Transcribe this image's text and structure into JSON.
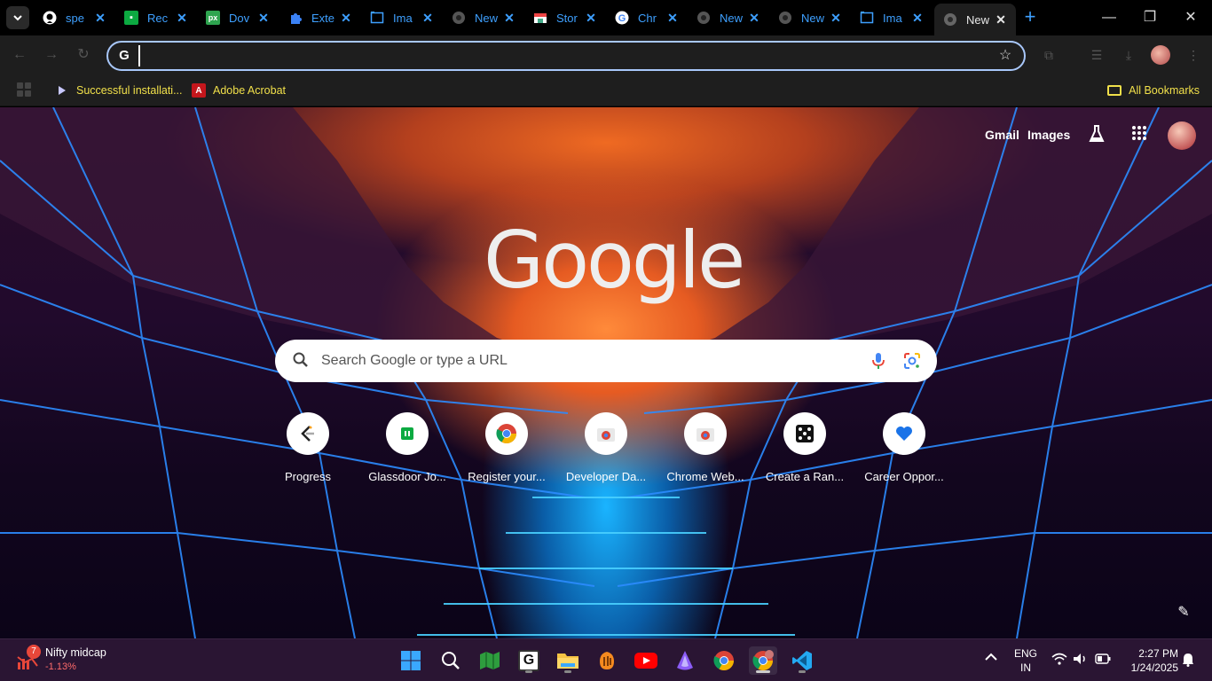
{
  "tabs": [
    {
      "label": "spe",
      "favicon": "github-icon"
    },
    {
      "label": "Rec",
      "favicon": "glassdoor-icon"
    },
    {
      "label": "Dov",
      "favicon": "pixabay-icon"
    },
    {
      "label": "Exte",
      "favicon": "extension-icon"
    },
    {
      "label": "Ima",
      "favicon": "image-icon"
    },
    {
      "label": "New",
      "favicon": "chrome-icon"
    },
    {
      "label": "Stor",
      "favicon": "store-icon"
    },
    {
      "label": "Chr",
      "favicon": "google-icon"
    },
    {
      "label": "New",
      "favicon": "chrome-icon"
    },
    {
      "label": "New",
      "favicon": "chrome-icon"
    },
    {
      "label": "Ima",
      "favicon": "image-icon"
    },
    {
      "label": "New",
      "favicon": "chrome-icon",
      "active": true
    }
  ],
  "omnibox": {
    "value": "",
    "placeholder": ""
  },
  "bookmarks": {
    "items": [
      {
        "label": "Successful installati...",
        "icon": "bookmark-arrow-icon"
      },
      {
        "label": "Adobe Acrobat",
        "icon": "acrobat-icon"
      }
    ],
    "all_bookmarks": "All Bookmarks"
  },
  "ntp": {
    "gmail": "Gmail",
    "images": "Images",
    "logo": "Google",
    "search_placeholder": "Search Google or type a URL",
    "shortcuts": [
      {
        "label": "Progress",
        "icon": "leetcode-icon"
      },
      {
        "label": "Glassdoor Jo...",
        "icon": "glassdoor-icon"
      },
      {
        "label": "Register your...",
        "icon": "chrome-icon"
      },
      {
        "label": "Developer Da...",
        "icon": "chrome-web-store-icon"
      },
      {
        "label": "Chrome Web...",
        "icon": "chrome-web-store-icon"
      },
      {
        "label": "Create a Ran...",
        "icon": "dice-icon"
      },
      {
        "label": "Career Oppor...",
        "icon": "heart-icon"
      }
    ]
  },
  "taskbar": {
    "widget_title": "Nifty midcap",
    "widget_value": "-1.13%",
    "widget_badge": "7",
    "lang_top": "ENG",
    "lang_bottom": "IN",
    "time": "2:27 PM",
    "date": "1/24/2025"
  },
  "colors": {
    "accent_tab": "#3ea0ff",
    "bookmark_text": "#f1e04a",
    "omnibox_border": "#a8c7fa"
  }
}
